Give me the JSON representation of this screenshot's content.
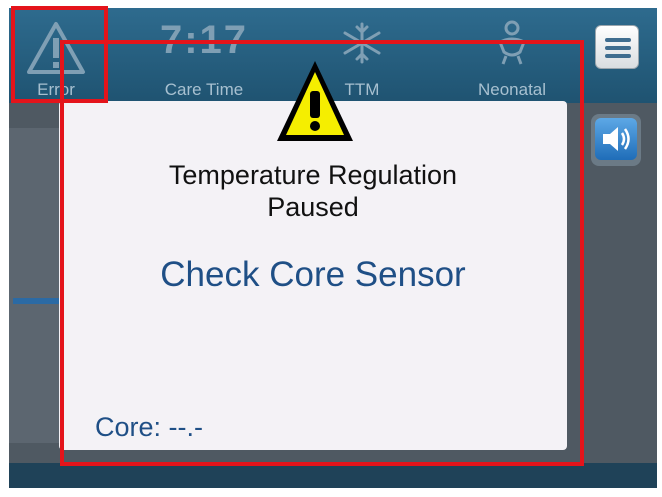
{
  "status_bar": {
    "error": {
      "label": "Error",
      "icon": "warning-triangle-icon"
    },
    "care_time": {
      "value": "7:17",
      "label": "Care Time"
    },
    "ttm": {
      "label": "TTM",
      "icon": "snowflake-icon"
    },
    "neonatal": {
      "label": "Neonatal",
      "icon": "baby-icon"
    }
  },
  "buttons": {
    "menu": {
      "icon": "hamburger-menu-icon"
    },
    "sound": {
      "icon": "speaker-icon"
    }
  },
  "dialog": {
    "icon": "warning-icon",
    "title": "Temperature Regulation Paused",
    "message": "Check Core Sensor",
    "core_label": "Core:",
    "core_value": "--.-"
  },
  "colors": {
    "highlight": "#e4141b",
    "accent_blue": "#1f4f86",
    "warning_yellow": "#f5ee00",
    "header": "#1f5371"
  }
}
